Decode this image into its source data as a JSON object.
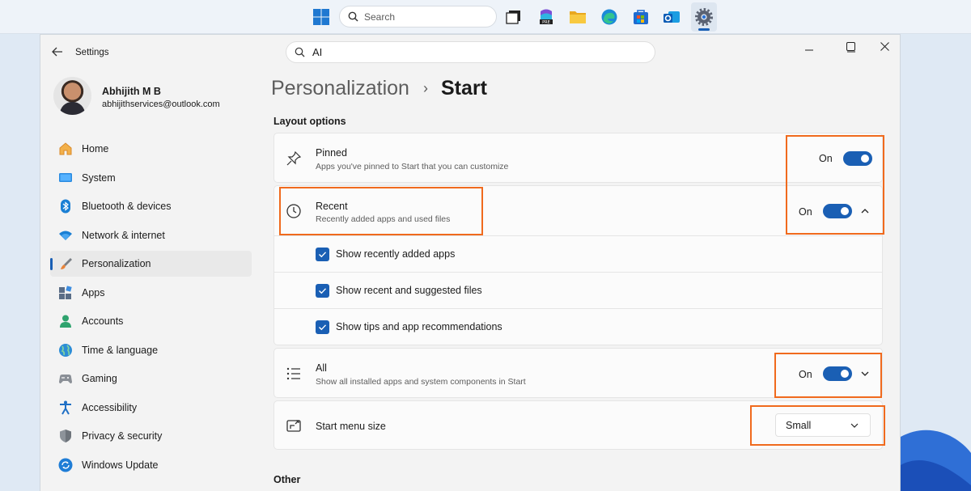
{
  "taskbar": {
    "search_placeholder": "Search",
    "icons": [
      "windows-start-icon",
      "search-icon",
      "task-view-icon",
      "copilot-365-icon",
      "file-explorer-icon",
      "edge-browser-icon",
      "microsoft-store-icon",
      "outlook-icon",
      "settings-icon"
    ],
    "badge": "PRE"
  },
  "window": {
    "app_title": "Settings",
    "search_value": "AI",
    "controls": [
      "minimize",
      "maximize",
      "close"
    ]
  },
  "profile": {
    "name": "Abhijith M B",
    "email": "abhijithservices@outlook.com"
  },
  "sidebar": {
    "items": [
      {
        "label": "Home",
        "icon": "home-icon",
        "color": "#e8a33d"
      },
      {
        "label": "System",
        "icon": "system-icon",
        "color": "#1a7fd4"
      },
      {
        "label": "Bluetooth & devices",
        "icon": "bluetooth-icon",
        "color": "#1a7fd4"
      },
      {
        "label": "Network & internet",
        "icon": "wifi-icon",
        "color": "#1a7fd4"
      },
      {
        "label": "Personalization",
        "icon": "brush-icon",
        "color": "#d8782e",
        "active": true
      },
      {
        "label": "Apps",
        "icon": "apps-icon",
        "color": "#5a6d86"
      },
      {
        "label": "Accounts",
        "icon": "accounts-icon",
        "color": "#2fa36e"
      },
      {
        "label": "Time & language",
        "icon": "globe-icon",
        "color": "#2c8dd6"
      },
      {
        "label": "Gaming",
        "icon": "gaming-icon",
        "color": "#6b6b6b"
      },
      {
        "label": "Accessibility",
        "icon": "accessibility-icon",
        "color": "#1f6fc5"
      },
      {
        "label": "Privacy & security",
        "icon": "shield-icon",
        "color": "#7a7f86"
      },
      {
        "label": "Windows Update",
        "icon": "update-icon",
        "color": "#1f7dd6"
      }
    ]
  },
  "main": {
    "breadcrumb_parent": "Personalization",
    "breadcrumb_sep": "›",
    "breadcrumb_current": "Start",
    "section_layout": "Layout options",
    "section_other": "Other",
    "pinned": {
      "title": "Pinned",
      "desc": "Apps you've pinned to Start that you can customize",
      "state": "On"
    },
    "recent": {
      "title": "Recent",
      "desc": "Recently added apps and used files",
      "state": "On"
    },
    "recent_options": [
      {
        "label": "Show recently added apps",
        "checked": true
      },
      {
        "label": "Show recent and suggested files",
        "checked": true
      },
      {
        "label": "Show tips and app recommendations",
        "checked": true
      }
    ],
    "all": {
      "title": "All",
      "desc": "Show all installed apps and system components in Start",
      "state": "On"
    },
    "menu_size": {
      "title": "Start menu size",
      "value": "Small"
    }
  },
  "colors": {
    "accent": "#1a5fb4",
    "highlight": "#f06a1d"
  }
}
